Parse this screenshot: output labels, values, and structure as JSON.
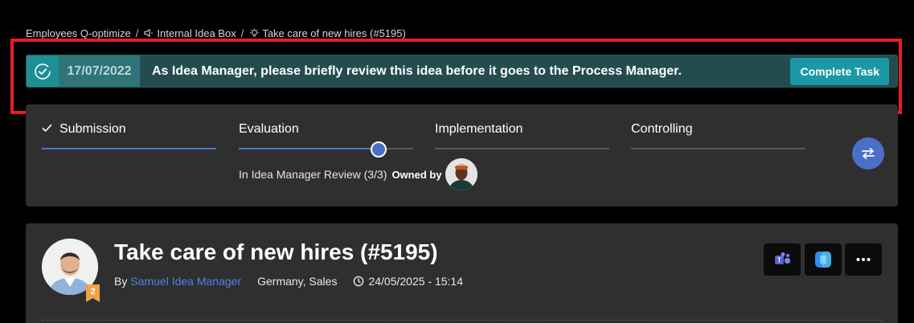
{
  "breadcrumb": {
    "items": [
      {
        "label": "Employees Q-optimize"
      },
      {
        "label": "Internal Idea Box",
        "icon": "megaphone-icon"
      },
      {
        "label": "Take care of new hires (#5195)",
        "icon": "lightbulb-icon"
      }
    ],
    "separator": "/"
  },
  "task_banner": {
    "icon": "check-circle-icon",
    "date": "17/07/2022",
    "message": "As Idea Manager, please briefly review this idea before it goes to the Process Manager.",
    "button_label": "Complete Task"
  },
  "progress": {
    "stages": [
      {
        "label": "Submission",
        "completed": true
      },
      {
        "label": "Evaluation",
        "completed": false,
        "current": true,
        "fill_fraction": 0.8
      },
      {
        "label": "Implementation",
        "completed": false
      },
      {
        "label": "Controlling",
        "completed": false
      }
    ],
    "status_text": "In Idea Manager Review (3/3)",
    "owned_by_label": "Owned by",
    "swap_icon": "swap-arrows-icon"
  },
  "idea": {
    "title": "Take care of new hires (#5195)",
    "by_label": "By",
    "author": "Samuel Idea Manager",
    "author_level": "2",
    "location": "Germany, Sales",
    "datetime": "24/05/2025 - 15:14",
    "actions": [
      "teams-icon",
      "copilot-icon",
      "more-options-icon"
    ]
  },
  "colors": {
    "accent_blue": "#4a6fc7",
    "teal_button": "#1a98a5",
    "banner_bg": "#244c4f",
    "highlight_red": "#e41f26",
    "link_blue": "#4d83e6"
  }
}
